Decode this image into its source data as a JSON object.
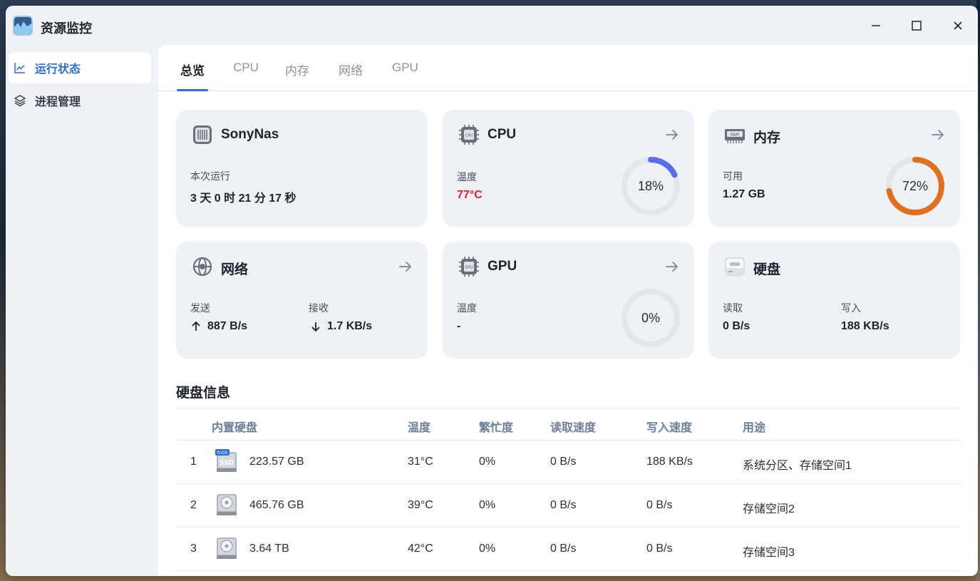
{
  "app": {
    "title": "资源监控"
  },
  "sidebar": {
    "items": [
      {
        "label": "运行状态",
        "icon": "chart-line-icon",
        "active": true
      },
      {
        "label": "进程管理",
        "icon": "layers-icon",
        "active": false
      }
    ]
  },
  "tabs": [
    "总览",
    "CPU",
    "内存",
    "网络",
    "GPU"
  ],
  "cards": {
    "system": {
      "title": "SonyNas",
      "uptime_label": "本次运行",
      "uptime_value": "3 天 0 时 21 分 17 秒"
    },
    "cpu": {
      "title": "CPU",
      "temp_label": "温度",
      "temp_value": "77°C",
      "usage_text": "18%",
      "usage": 0.18
    },
    "memory": {
      "title": "内存",
      "avail_label": "可用",
      "avail_value": "1.27 GB",
      "usage_text": "72%",
      "usage": 0.72
    },
    "network": {
      "title": "网络",
      "send_label": "发送",
      "send_value": "887 B/s",
      "recv_label": "接收",
      "recv_value": "1.7 KB/s"
    },
    "gpu": {
      "title": "GPU",
      "temp_label": "温度",
      "temp_value": "-",
      "usage_text": "0%",
      "usage": 0
    },
    "disk": {
      "title": "硬盘",
      "read_label": "读取",
      "read_value": "0 B/s",
      "write_label": "写入",
      "write_value": "188 KB/s"
    }
  },
  "disk_info": {
    "title": "硬盘信息",
    "headers": [
      "内置硬盘",
      "温度",
      "繁忙度",
      "读取速度",
      "写入速度",
      "用途"
    ],
    "rows": [
      {
        "index": "1",
        "badge": "fnOS",
        "size": "223.57 GB",
        "temp": "31°C",
        "busy": "0%",
        "read": "0 B/s",
        "write": "188 KB/s",
        "usage": "系统分区、存储空间1"
      },
      {
        "index": "2",
        "size": "465.76 GB",
        "temp": "39°C",
        "busy": "0%",
        "read": "0 B/s",
        "write": "0 B/s",
        "usage": "存储空间2"
      },
      {
        "index": "3",
        "size": "3.64 TB",
        "temp": "42°C",
        "busy": "0%",
        "read": "0 B/s",
        "write": "0 B/s",
        "usage": "存储空间3"
      }
    ]
  },
  "colors": {
    "accent": "#2d6fd6",
    "cpu_ring": "#5b6cf0",
    "mem_ring": "#e07020",
    "temp_warn": "#e01f2d",
    "ring_track": "#e3e6ea"
  }
}
